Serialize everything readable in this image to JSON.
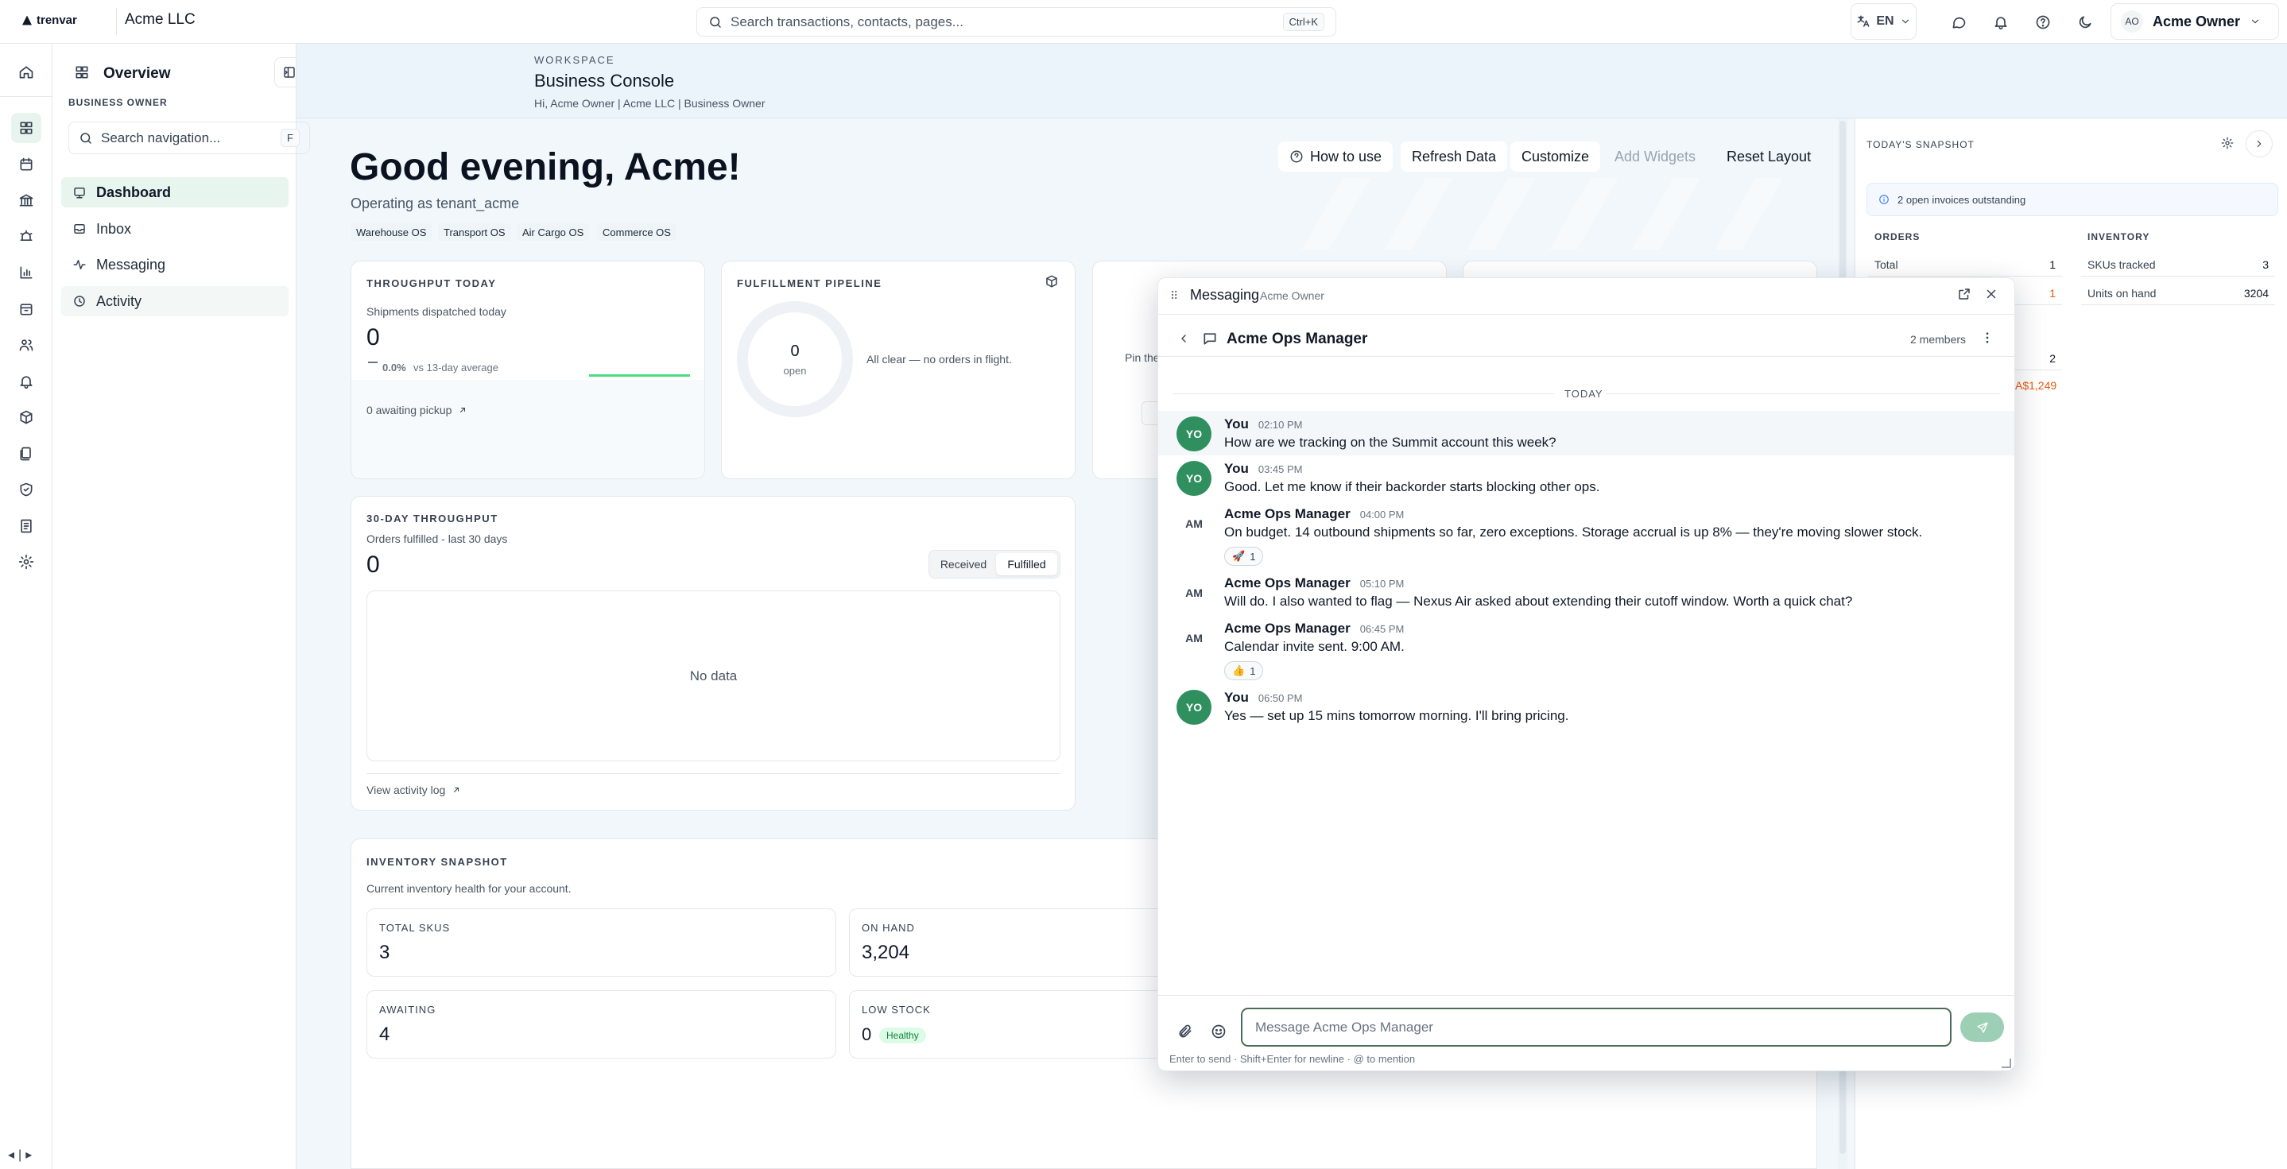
{
  "topbar": {
    "brand": "trenvar",
    "org": "Acme LLC",
    "search_placeholder": "Search transactions, contacts, pages...",
    "search_shortcut": "Ctrl+K",
    "lang": "EN",
    "user_initials": "AO",
    "user_name": "Acme Owner"
  },
  "nav": {
    "title": "Overview",
    "role": "BUSINESS OWNER",
    "search_placeholder": "Search navigation...",
    "search_shortcut": "F",
    "items": [
      {
        "label": "Dashboard"
      },
      {
        "label": "Inbox"
      },
      {
        "label": "Messaging"
      },
      {
        "label": "Activity"
      }
    ]
  },
  "workspace": {
    "label": "WORKSPACE",
    "title": "Business Console",
    "subtitle": "Hi, Acme Owner | Acme LLC | Business Owner"
  },
  "dashboard": {
    "greeting": "Good evening, Acme!",
    "operating": "Operating as tenant_acme",
    "chips": [
      "Warehouse OS",
      "Transport OS",
      "Air Cargo OS",
      "Commerce OS"
    ],
    "actions": {
      "how": "How to use",
      "refresh": "Refresh Data",
      "customize": "Customize",
      "add": "Add Widgets",
      "reset": "Reset Layout"
    },
    "throughput": {
      "label": "THROUGHPUT TODAY",
      "sub": "Shipments dispatched today",
      "value": "0",
      "delta": "0.0%",
      "delta_note": "vs 13-day average",
      "link": "0 awaiting pickup"
    },
    "pipeline": {
      "label": "FULFILLMENT PIPELINE",
      "value": "0",
      "value_label": "open",
      "status": "All clear — no orders in flight."
    },
    "pin_text": "Pin the",
    "thirty": {
      "label": "30-DAY THROUGHPUT",
      "sub": "Orders fulfilled - last 30 days",
      "value": "0",
      "toggle": [
        "Received",
        "Fulfilled"
      ],
      "empty": "No data",
      "link": "View activity log"
    },
    "inventory": {
      "label": "INVENTORY SNAPSHOT",
      "sub": "Current inventory health for your account.",
      "tiles": {
        "total_label": "TOTAL SKUS",
        "total_value": "3",
        "onhand_label": "ON HAND",
        "onhand_value": "3,204",
        "awaiting_label": "AWAITING",
        "awaiting_value": "4",
        "low_label": "LOW STOCK",
        "low_value": "0",
        "low_tag": "Healthy"
      }
    }
  },
  "snapshot": {
    "title": "TODAY'S SNAPSHOT",
    "alert": "2 open invoices outstanding",
    "orders_label": "ORDERS",
    "orders_total_label": "Total",
    "orders_total_value": "1",
    "orders_row2_value": "1",
    "inventory_label": "INVENTORY",
    "skus_label": "SKUs tracked",
    "skus_value": "3",
    "units_label": "Units on hand",
    "units_value": "3204",
    "extra_value": "2",
    "amount": "A$1,249"
  },
  "messaging": {
    "title": "Messaging",
    "subtitle": "Acme Owner",
    "thread": "Acme Ops Manager",
    "members": "2 members",
    "day": "TODAY",
    "messages": [
      {
        "initials": "YO",
        "name": "You",
        "time": "02:10 PM",
        "text": "How are we tracking on the Summit account this week?"
      },
      {
        "initials": "YO",
        "name": "You",
        "time": "03:45 PM",
        "text": "Good. Let me know if their backorder starts blocking other ops."
      },
      {
        "initials": "AM",
        "name": "Acme Ops Manager",
        "time": "04:00 PM",
        "text": "On budget. 14 outbound shipments so far, zero exceptions. Storage accrual is up 8% — they're moving slower stock.",
        "reaction_emoji": "🚀",
        "reaction_count": "1"
      },
      {
        "initials": "AM",
        "name": "Acme Ops Manager",
        "time": "05:10 PM",
        "text": "Will do. I also wanted to flag — Nexus Air asked about extending their cutoff window. Worth a quick chat?"
      },
      {
        "initials": "AM",
        "name": "Acme Ops Manager",
        "time": "06:45 PM",
        "text": "Calendar invite sent. 9:00 AM.",
        "reaction_emoji": "👍",
        "reaction_count": "1"
      },
      {
        "initials": "YO",
        "name": "You",
        "time": "06:50 PM",
        "text": "Yes — set up 15 mins tomorrow morning. I'll bring pricing."
      }
    ],
    "input_placeholder": "Message Acme Ops Manager",
    "hint": "Enter to send · Shift+Enter for newline · @ to mention"
  }
}
